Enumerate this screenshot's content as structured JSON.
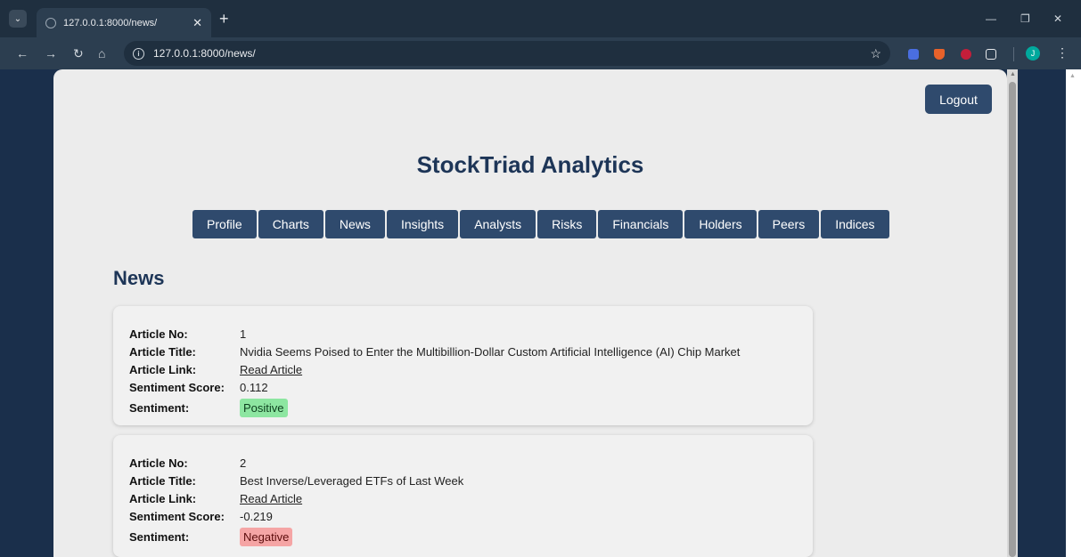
{
  "browser": {
    "tab_title": "127.0.0.1:8000/news/",
    "url": "127.0.0.1:8000/news/",
    "profile_initial": "J"
  },
  "page": {
    "logout_label": "Logout",
    "app_title": "StockTriad Analytics",
    "section_title": "News",
    "nav_items": [
      "Profile",
      "Charts",
      "News",
      "Insights",
      "Analysts",
      "Risks",
      "Financials",
      "Holders",
      "Peers",
      "Indices"
    ]
  },
  "labels": {
    "article_no": "Article No:",
    "article_title": "Article Title:",
    "article_link": "Article Link:",
    "sentiment_score": "Sentiment Score:",
    "sentiment": "Sentiment:"
  },
  "articles": [
    {
      "no": "1",
      "title": "Nvidia Seems Poised to Enter the Multibillion-Dollar Custom Artificial Intelligence (AI) Chip Market",
      "link_text": "Read Article",
      "score": "0.112",
      "sentiment": "Positive"
    },
    {
      "no": "2",
      "title": "Best Inverse/Leveraged ETFs of Last Week",
      "link_text": "Read Article",
      "score": "-0.219",
      "sentiment": "Negative"
    }
  ],
  "colors": {
    "brand": "#1d3557",
    "button": "#2f4a6d",
    "positive": "#8de6a1",
    "negative": "#f5a5a5"
  }
}
